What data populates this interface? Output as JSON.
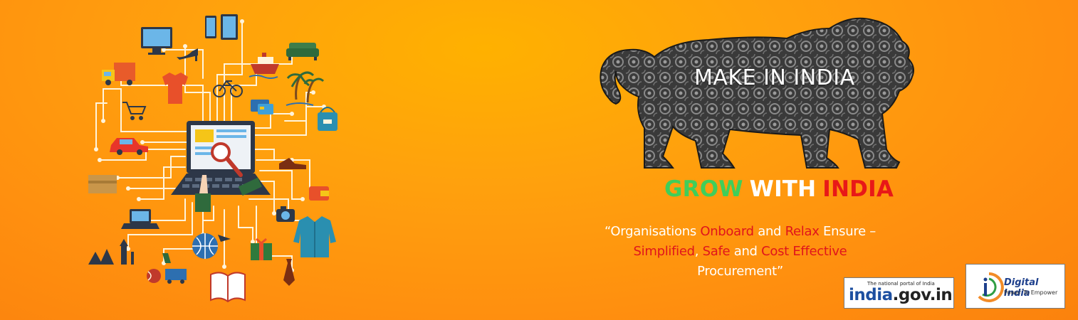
{
  "lion": {
    "title": "MAKE IN INDIA"
  },
  "grow": {
    "word1": "GROW",
    "word2": "WITH",
    "word3": "INDIA"
  },
  "tagline": {
    "open_quote": "“",
    "w1": "Organisations ",
    "w2": "Onboard",
    "w3": " and ",
    "w4": "Relax",
    "w5": " Ensure –",
    "w6": "Simplified",
    "w7": ", ",
    "w8": "Safe",
    "w9": " and ",
    "w10": "Cost Effective",
    "w11": "Procurement",
    "close_quote": "”"
  },
  "badges": {
    "indiagov": {
      "small": "The national portal of India",
      "main_blue": "india",
      "main_dark": ".gov.in"
    },
    "digital_india": {
      "title": "Digital India",
      "subtitle": "Power To Empower"
    }
  },
  "colors": {
    "background": "#ffa10d",
    "green": "#3fce5a",
    "red": "#e81818",
    "white": "#ffffff"
  },
  "icons": [
    "monitor-icon",
    "tablet-icon",
    "sofa-icon",
    "delivery-truck-icon",
    "high-heel-icon",
    "ship-icon",
    "tshirt-icon",
    "bicycle-icon",
    "palm-tree-icon",
    "shopping-cart-icon",
    "credit-card-icon",
    "handbag-icon",
    "car-icon",
    "laptop-search-icon",
    "shoe-icon",
    "parcel-box-icon",
    "wallet-icon",
    "laptop-icon",
    "camera-icon",
    "globe-plane-icon",
    "gift-icon",
    "shirt-icon",
    "monuments-icon",
    "sports-icon",
    "book-icon",
    "tie-icon"
  ]
}
